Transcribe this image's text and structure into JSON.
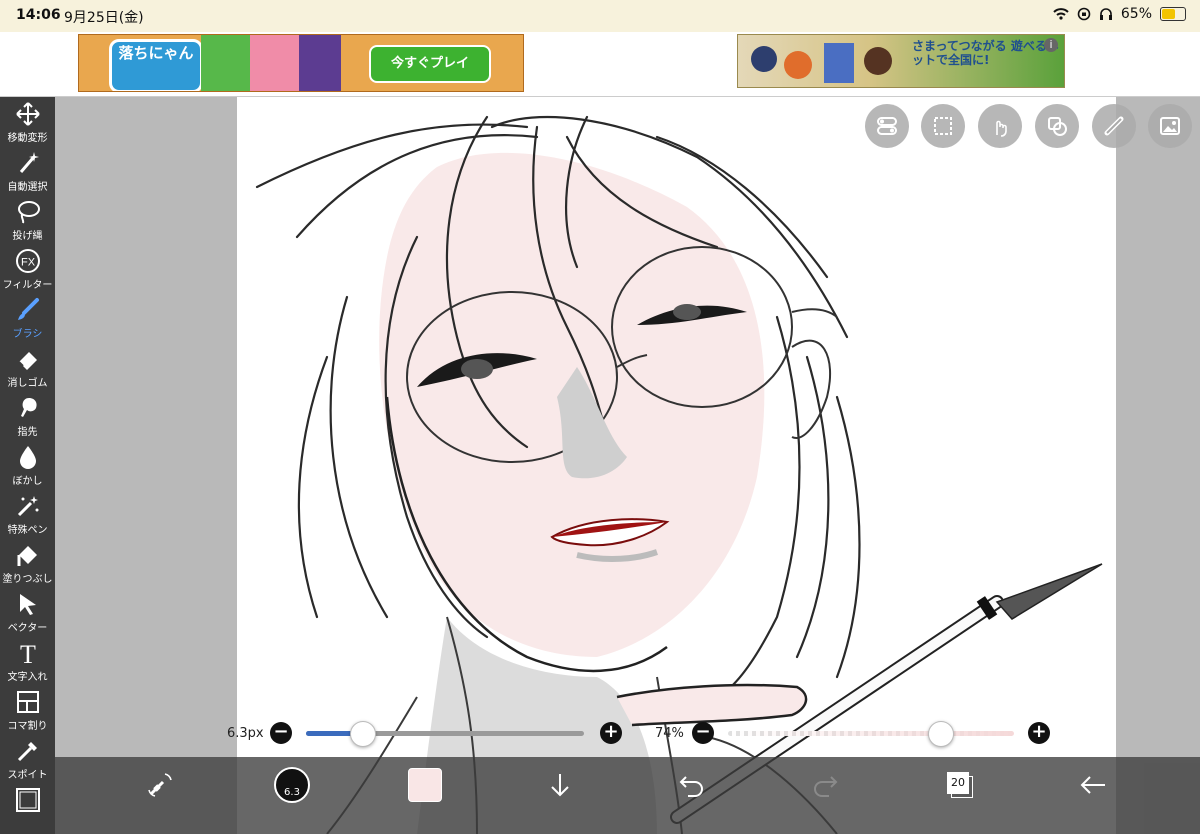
{
  "status_bar": {
    "time": "14:06",
    "date": "9月25日(金)",
    "battery": "65%",
    "battery_level": 0.65
  },
  "ads": {
    "left_logo": "落ちにゃん",
    "left_cta": "今すぐプレイ",
    "right_copy": "さまってつながる 遊べるネットで全国に!",
    "right_info": "i"
  },
  "toolbar": {
    "tools": [
      {
        "label": "移動変形",
        "icon": "move-icon"
      },
      {
        "label": "自動選択",
        "icon": "magic-wand-icon"
      },
      {
        "label": "投げ縄",
        "icon": "lasso-icon"
      },
      {
        "label": "フィルター",
        "icon": "fx-icon"
      },
      {
        "label": "ブラシ",
        "icon": "brush-icon"
      },
      {
        "label": "消しゴム",
        "icon": "eraser-icon"
      },
      {
        "label": "指先",
        "icon": "smudge-icon"
      },
      {
        "label": "ぼかし",
        "icon": "blur-drop-icon"
      },
      {
        "label": "特殊ペン",
        "icon": "special-pen-icon"
      },
      {
        "label": "塗りつぶし",
        "icon": "bucket-icon"
      },
      {
        "label": "ベクター",
        "icon": "vector-arrow-icon"
      },
      {
        "label": "文字入れ",
        "icon": "text-icon"
      },
      {
        "label": "コマ割り",
        "icon": "frame-divider-icon"
      },
      {
        "label": "スポイト",
        "icon": "eyedropper-icon"
      }
    ],
    "fx_text": "FX",
    "text_tool_glyph": "T",
    "active": "ブラシ",
    "active_color": "#5aa0ff"
  },
  "top_buttons": [
    "toggle-icon",
    "selection-icon",
    "touch-icon",
    "layer-copy-icon",
    "ruler-icon",
    "image-icon"
  ],
  "sliders": {
    "brush_size_label": "6.3px",
    "brush_size_fraction": 0.2,
    "opacity_label": "74%",
    "opacity_fraction": 0.74,
    "minus": "−",
    "plus": "+"
  },
  "bottom_bar": {
    "brush_preview_value": "6.3",
    "layer_count": "20",
    "color_swatch": "#f9e6e6"
  },
  "colors": {
    "toolbar_bg": "#3c3c3c",
    "accent_blue": "#3b6bbd",
    "skin": "#f9e9e9",
    "lips": "#a01313"
  }
}
